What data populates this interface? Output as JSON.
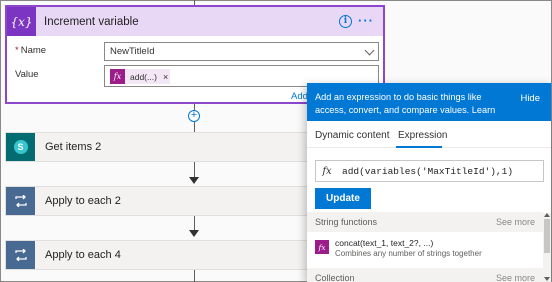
{
  "increment_card": {
    "icon_text": "{x}",
    "title": "Increment variable",
    "info_icon": "info-icon",
    "more_icon": "more-options-icon",
    "name_label": "Name",
    "name_required_mark": "*",
    "name_value": "NewTitleId",
    "value_label": "Value",
    "value_token": {
      "icon": "fx",
      "label": "add(...)",
      "remove": "×"
    },
    "add_link": "Add"
  },
  "actions": [
    {
      "title": "Get items 2",
      "icon": "sharepoint-icon",
      "icon_text": "S"
    },
    {
      "title": "Apply to each 2",
      "icon": "loop-icon"
    },
    {
      "title": "Apply to each 4",
      "icon": "loop-icon"
    }
  ],
  "expression_panel": {
    "header_text": "Add an expression to do basic things like access, convert, and compare values.",
    "learn_more": "Learn more",
    "hide_label": "Hide",
    "tabs": [
      {
        "label": "Dynamic content",
        "active": false
      },
      {
        "label": "Expression",
        "active": true
      }
    ],
    "fx_symbol": "fx",
    "expression": "add(variables('MaxTitleId'),1)",
    "update_label": "Update",
    "sections": [
      {
        "title": "String functions",
        "see_more": "See more"
      },
      {
        "title": "Collection",
        "see_more": "See more"
      }
    ],
    "functions": [
      {
        "name": "concat(text_1, text_2?, ...)",
        "description": "Combines any number of strings together"
      }
    ]
  },
  "colors": {
    "variable_accent": "#7b35c2",
    "variable_header_bg": "#e8d8f5",
    "primary_blue": "#0078d4",
    "expression_token": "#9b1d8a",
    "sharepoint_teal": "#036c70",
    "loop_blue": "#486991"
  }
}
